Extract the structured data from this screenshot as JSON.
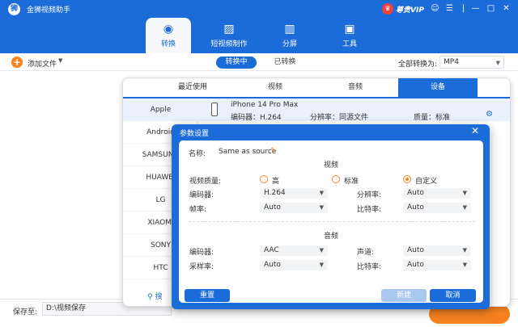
{
  "app": {
    "title": "金狮视频助手",
    "logo": "lion-logo",
    "vip": "尊贵VIP"
  },
  "nav": {
    "tabs": [
      {
        "label": "转换",
        "icon": "convert-icon"
      },
      {
        "label": "短视频制作",
        "icon": "image-icon"
      },
      {
        "label": "分屏",
        "icon": "split-screen-icon"
      },
      {
        "label": "工具",
        "icon": "toolbox-icon"
      }
    ]
  },
  "toolbar": {
    "add_file": "添加文件",
    "converting": "转换中",
    "converted": "已转换",
    "convert_all_to": "全部转换为:",
    "format": "MP4"
  },
  "bottom": {
    "save_to": "保存至:",
    "save_path": "D:\\视频保存"
  },
  "device_panel": {
    "tabs": [
      "最近使用",
      "视频",
      "音频",
      "设备"
    ],
    "brands": [
      "Apple",
      "Android",
      "SAMSUNG",
      "HUAWEI",
      "LG",
      "XIAOMI",
      "SONY",
      "HTC"
    ],
    "search": "搜",
    "device": {
      "name": "iPhone 14 Pro Max",
      "encoder": "编码器：H.264",
      "resolution": "分辨率：同源文件",
      "quality": "质量：标准"
    }
  },
  "dialog": {
    "title": "参数设置",
    "name_label": "名称:",
    "name_value": "Same as source",
    "video_section": "视频",
    "video_quality_label": "视频质量:",
    "quality_options": [
      "高",
      "标准",
      "自定义"
    ],
    "quality_selected": "自定义",
    "video_encoder_label": "编码器:",
    "video_encoder": "H.264",
    "resolution_label": "分辨率:",
    "resolution": "Auto",
    "framerate_label": "帧率:",
    "framerate": "Auto",
    "bitrate_label": "比特率:",
    "bitrate": "Auto",
    "audio_section": "音频",
    "audio_encoder_label": "编码器:",
    "audio_encoder": "AAC",
    "channel_label": "声道:",
    "channel": "Auto",
    "samplerate_label": "采样率:",
    "samplerate": "Auto",
    "audio_bitrate_label": "比特率:",
    "audio_bitrate": "Auto",
    "reset": "重置",
    "new": "新建",
    "cancel": "取消"
  }
}
